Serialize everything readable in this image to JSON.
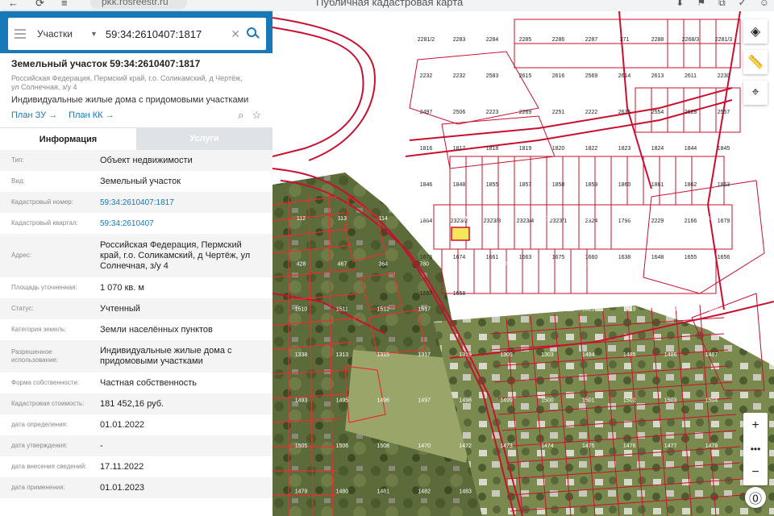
{
  "browser": {
    "url": "pkk.rosreestr.ru",
    "page_title": "Публичная кадастровая карта",
    "notif_badge": "3",
    "ext_badge": "7"
  },
  "search": {
    "mode": "Участки",
    "query": "59:34:2610407:1817"
  },
  "object": {
    "title": "Земельный участок 59:34:2610407:1817",
    "address_small": "Российская Федерация, Пермский край, г.о. Соликамский, д Чертёж, ул Солнечная, з/у 4",
    "use": "Индивидуальные жилые дома с придомовыми участками",
    "plan_zu": "План ЗУ →",
    "plan_kk": "План КК →"
  },
  "tabs": {
    "info": "Информация",
    "services": "Услуги"
  },
  "rows": [
    {
      "label": "Тип:",
      "value": "Объект недвижимости"
    },
    {
      "label": "Вид:",
      "value": "Земельный участок"
    },
    {
      "label": "Кадастровый номер:",
      "value": "59:34:2610407:1817"
    },
    {
      "label": "Кадастровый квартал:",
      "value": "59:34:2610407"
    },
    {
      "label": "Адрес:",
      "value": "Российская Федерация, Пермский край, г.о. Соликамский, д Чертёж, ул Солнечная, з/у 4"
    },
    {
      "label": "Площадь уточненная:",
      "value": "1 070 кв. м"
    },
    {
      "label": "Статус:",
      "value": "Учтенный"
    },
    {
      "label": "Категория земель:",
      "value": "Земли населённых пунктов"
    },
    {
      "label": "Разрешенное использование:",
      "value": "Индивидуальные жилые дома с придомовыми участками"
    },
    {
      "label": "Форма собственности:",
      "value": "Частная собственность"
    },
    {
      "label": "Кадастровая стоимость:",
      "value": "181 452,16 руб."
    },
    {
      "label": "дата определения:",
      "value": "01.01.2022"
    },
    {
      "label": "дата утверждения:",
      "value": "-"
    },
    {
      "label": "дата внесения сведений:",
      "value": "17.11.2022"
    },
    {
      "label": "дата применения:",
      "value": "01.01.2023"
    }
  ],
  "map": {
    "parcels_white": [
      "2281/2",
      "2283",
      "2284",
      "2285",
      "2286",
      "2287",
      "371",
      "2288",
      "2268/3",
      "2281/3",
      "2232",
      "2232",
      "2583",
      "2615",
      "2616",
      "2569",
      "2614",
      "2613",
      "2611",
      "2230",
      "2497",
      "2506",
      "2223",
      "2269",
      "2251",
      "2222",
      "2635",
      "2554",
      "2628",
      "2557",
      "1816",
      "1817",
      "1818",
      "1819",
      "1820",
      "1822",
      "1823",
      "1824",
      "1844",
      "1845",
      "1846",
      "1848",
      "1855",
      "1857",
      "1858",
      "1859",
      "1860",
      "1861",
      "1862",
      "1863",
      "1864",
      "2323/2",
      "2323/3",
      "2323/4",
      "2323/1",
      "2324",
      "1796",
      "2229",
      "2166",
      "1679",
      "1676",
      "1674",
      "1661",
      "1663",
      "1675",
      "1660",
      "1638",
      "1648",
      "1655",
      "1656",
      "1657",
      "1658"
    ],
    "parcels_photo": [
      "112",
      "113",
      "114",
      "100",
      "299",
      "404",
      "614",
      "256",
      "656",
      "363",
      "334",
      "428",
      "467",
      "364",
      "780",
      "451",
      "648",
      "421",
      "336",
      "336",
      "334",
      "134",
      "1510",
      "1511",
      "1512",
      "1517",
      "1520",
      "1521",
      "1522",
      "1525",
      "1519",
      "1340",
      "1339",
      "1338",
      "1313",
      "1315",
      "1317",
      "1319",
      "1309",
      "1303",
      "1484",
      "1485",
      "1486",
      "1487",
      "1493",
      "1495",
      "1496",
      "1497",
      "1498",
      "1499",
      "1500",
      "1501",
      "1502",
      "1503",
      "1504",
      "1505",
      "1506",
      "1508",
      "1470",
      "1472",
      "1473",
      "1474",
      "1475",
      "1476",
      "1477",
      "1478",
      "1479",
      "1480",
      "1481",
      "1482",
      "1483"
    ],
    "colors": {
      "boundary": "#c8102e",
      "selected": "#f5e65a",
      "panel_accent": "#1779b8"
    }
  }
}
